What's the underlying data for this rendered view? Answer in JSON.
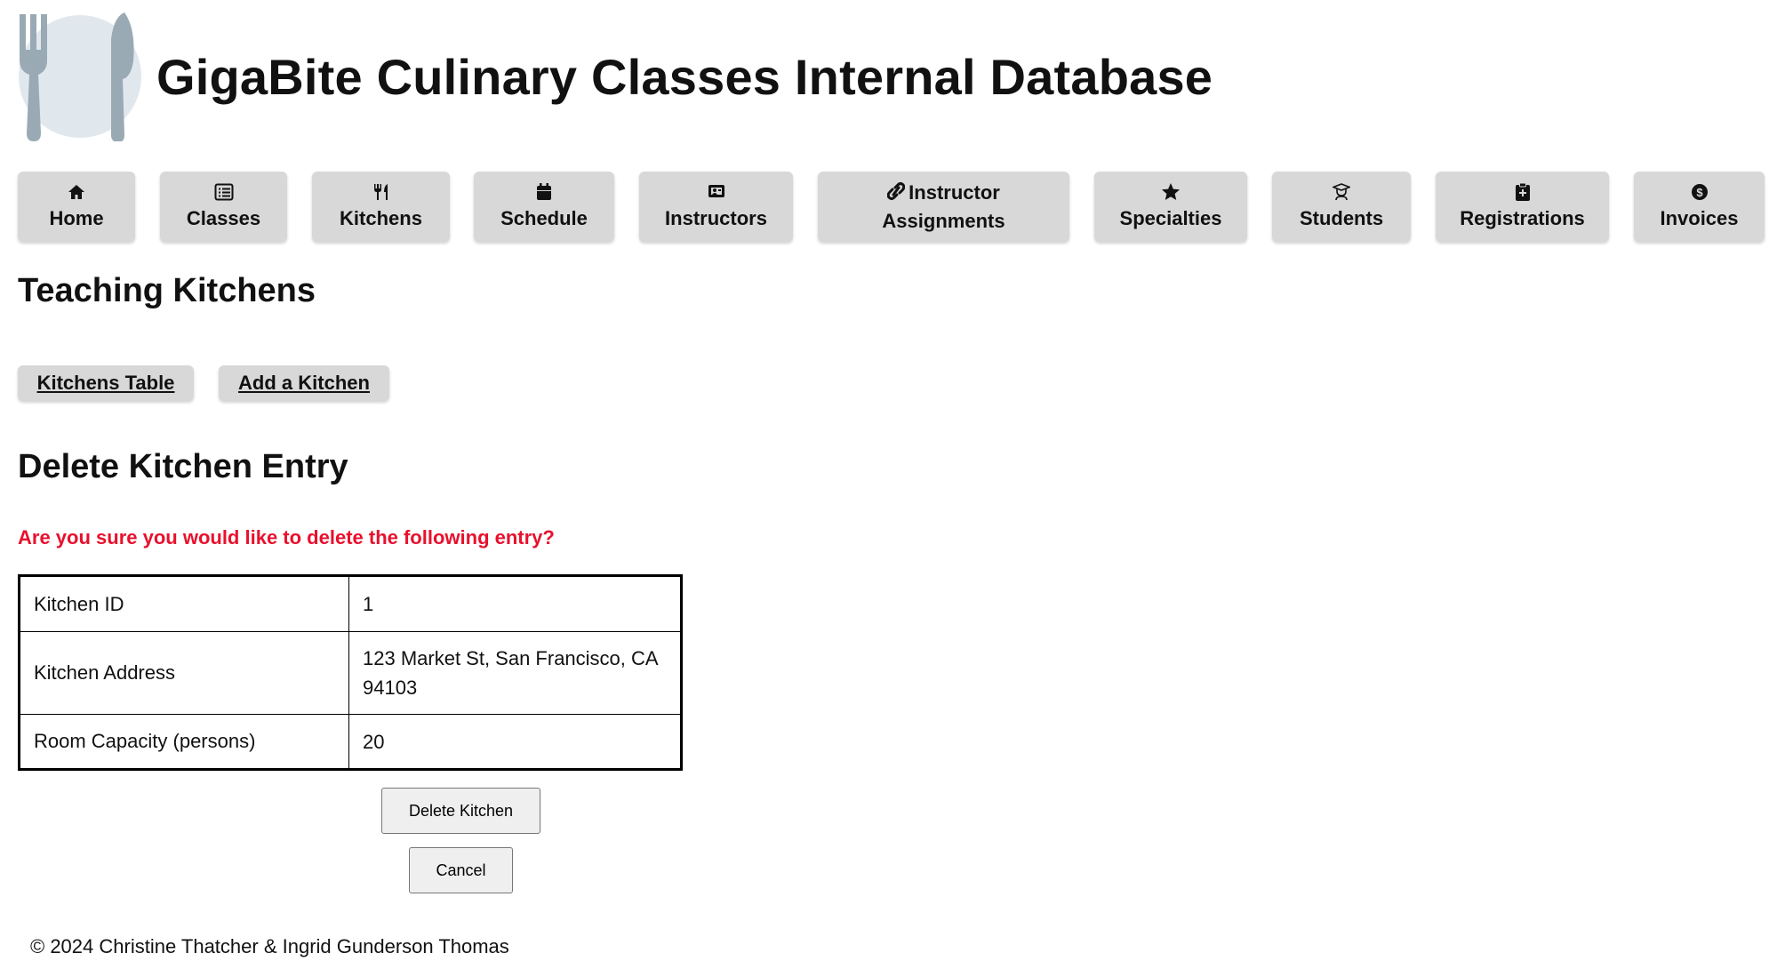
{
  "header": {
    "title": "GigaBite Culinary Classes Internal Database",
    "logo_icon": "fork-knife-plate-icon"
  },
  "nav": {
    "items": [
      {
        "label": "Home",
        "icon": "home-icon"
      },
      {
        "label": "Classes",
        "icon": "list-icon"
      },
      {
        "label": "Kitchens",
        "icon": "utensils-icon"
      },
      {
        "label": "Schedule",
        "icon": "calendar-icon"
      },
      {
        "label": "Instructors",
        "icon": "chalkboard-icon"
      },
      {
        "label_line1": "Instructor",
        "label_line2": "Assignments",
        "icon": "link-icon"
      },
      {
        "label": "Specialties",
        "icon": "star-icon"
      },
      {
        "label": "Students",
        "icon": "graduate-icon"
      },
      {
        "label": "Registrations",
        "icon": "clipboard-icon"
      },
      {
        "label": "Invoices",
        "icon": "dollar-icon"
      }
    ]
  },
  "section": {
    "title": "Teaching Kitchens",
    "links": {
      "table": "Kitchens Table",
      "add": "Add a Kitchen"
    }
  },
  "delete": {
    "title": "Delete Kitchen Entry",
    "warning": "Are you sure you would like to delete the following entry?",
    "rows": [
      {
        "key": "Kitchen ID",
        "value": "1"
      },
      {
        "key": "Kitchen Address",
        "value_line1": "123 Market St, San Francisco, CA",
        "value_line2": "94103"
      },
      {
        "key": "Room Capacity (persons)",
        "value": "20"
      }
    ],
    "delete_button": "Delete Kitchen",
    "cancel_button": "Cancel"
  },
  "footer": {
    "text": "© 2024 Christine Thatcher & Ingrid Gunderson Thomas"
  },
  "colors": {
    "nav_bg": "#d8d8d8",
    "warning": "#e8112d"
  }
}
